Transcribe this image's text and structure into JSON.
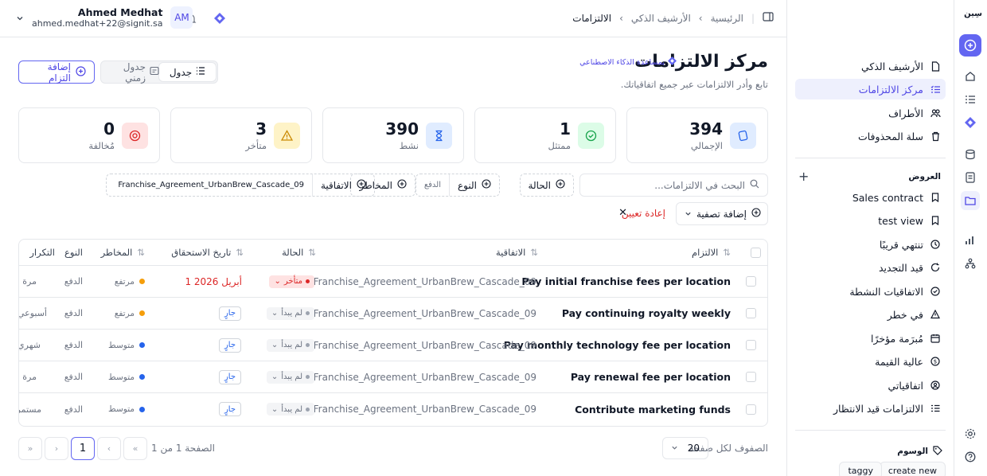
{
  "app": {
    "logo_text": "سِين"
  },
  "breadcrumb": {
    "home": "الرئيسية",
    "archive": "الأرشيف الذكي",
    "current": "الالتزامات"
  },
  "user": {
    "name": "Ahmed Medhat",
    "email": "ahmed.medhat+22@signit.sa",
    "initials": "AM"
  },
  "page": {
    "title": "مركز الالتزامات",
    "ai_badge": "بمساعدة الذكاء الاصطناعي",
    "subtitle": "تابع وأدر الالتزامات عبر جميع اتفاقياتك.",
    "add_button": "إضافة التزام",
    "view_table": "جدول",
    "view_timeline": "جدول زمني"
  },
  "stats": [
    {
      "value": "394",
      "label": "الإجمالي",
      "color": "#2563eb",
      "bg": "#e0ecff"
    },
    {
      "value": "1",
      "label": "ممتثل",
      "color": "#16a34a",
      "bg": "#dcfce7"
    },
    {
      "value": "390",
      "label": "نشط",
      "color": "#2563eb",
      "bg": "#e0ecff"
    },
    {
      "value": "3",
      "label": "متأخر",
      "color": "#ca8a04",
      "bg": "#fef3c7"
    },
    {
      "value": "0",
      "label": "مُخالفة",
      "color": "#dc2626",
      "bg": "#fee2e2"
    }
  ],
  "filters": {
    "search_placeholder": "البحث في الالتزامات...",
    "status": "الحالة",
    "type": "النوع",
    "type_value": "الدفع",
    "risk": "المخاطر",
    "agreement": "الاتفاقية",
    "agreement_value": "Franchise_Agreement_UrbanBrew_Cascade_09",
    "add_filter": "إضافة تصفية",
    "reset": "إعادة تعيين"
  },
  "table": {
    "headers": {
      "obligation": "الالتزام",
      "agreement": "الاتفاقية",
      "status": "الحالة",
      "due": "تاريخ الاستحقاق",
      "risk": "المخاطر",
      "type": "النوع",
      "frequency": "التكرار"
    },
    "rows": [
      {
        "name": "Pay initial franchise fees per location",
        "agreement": "Franchise_Agreement_UrbanBrew_Cascade_09",
        "status": "متأخر",
        "status_kind": "late",
        "due": "1 أبريل 2026",
        "current": "",
        "risk": "مرتفع",
        "risk_color": "#f59e0b",
        "type": "الدفع",
        "frequency": "مرة واحدة"
      },
      {
        "name": "Pay continuing royalty weekly",
        "agreement": "Franchise_Agreement_UrbanBrew_Cascade_09",
        "status": "لم يبدأ",
        "status_kind": "todo",
        "due": "",
        "current": "جارٍ",
        "risk": "مرتفع",
        "risk_color": "#f59e0b",
        "type": "الدفع",
        "frequency": "أسبوعي"
      },
      {
        "name": "Pay monthly technology fee per location",
        "agreement": "Franchise_Agreement_UrbanBrew_Cascade_09",
        "status": "لم يبدأ",
        "status_kind": "todo",
        "due": "",
        "current": "جارٍ",
        "risk": "متوسط",
        "risk_color": "#2563eb",
        "type": "الدفع",
        "frequency": "شهري"
      },
      {
        "name": "Pay renewal fee per location",
        "agreement": "Franchise_Agreement_UrbanBrew_Cascade_09",
        "status": "لم يبدأ",
        "status_kind": "todo",
        "due": "",
        "current": "جارٍ",
        "risk": "متوسط",
        "risk_color": "#2563eb",
        "type": "الدفع",
        "frequency": "مرة واحدة"
      },
      {
        "name": "Contribute marketing funds",
        "agreement": "Franchise_Agreement_UrbanBrew_Cascade_09",
        "status": "لم يبدأ",
        "status_kind": "todo",
        "due": "",
        "current": "جارٍ",
        "risk": "متوسط",
        "risk_color": "#2563eb",
        "type": "الدفع",
        "frequency": "مستمر"
      }
    ]
  },
  "pagination": {
    "rows_per_page_label": "الصفوف لكل صفحة",
    "rows_per_page": "20",
    "page_info": "الصفحة 1 من 1",
    "current_page": "1"
  },
  "sidebar": {
    "items": [
      {
        "label": "الأرشيف الذكي",
        "icon": "file-icon"
      },
      {
        "label": "مركز الالتزامات",
        "icon": "list-check-icon",
        "active": true
      },
      {
        "label": "الأطراف",
        "icon": "users-icon"
      },
      {
        "label": "سلة المحذوفات",
        "icon": "trash-icon"
      }
    ],
    "views_heading": "العروض",
    "views": [
      {
        "label": "Sales contract",
        "icon": "bookmark-icon"
      },
      {
        "label": "test view",
        "icon": "bookmark-icon"
      },
      {
        "label": "تنتهي قريبًا",
        "icon": "clock-icon"
      },
      {
        "label": "قيد التجديد",
        "icon": "refresh-icon"
      },
      {
        "label": "الاتفاقيات النشطة",
        "icon": "check-circle-icon"
      },
      {
        "label": "في خطر",
        "icon": "warning-icon"
      },
      {
        "label": "مُبرَمة مؤخرًا",
        "icon": "calendar-icon"
      },
      {
        "label": "عالية القيمة",
        "icon": "dollar-icon"
      },
      {
        "label": "اتفاقياتي",
        "icon": "user-circle-icon"
      },
      {
        "label": "الالتزامات قيد الانتظار",
        "icon": "list-check-icon"
      }
    ],
    "tags_heading": "الوسوم",
    "tags": [
      "create new",
      "taggy"
    ]
  },
  "colors": {
    "accent": "#6366f1",
    "danger": "#dc2626"
  }
}
